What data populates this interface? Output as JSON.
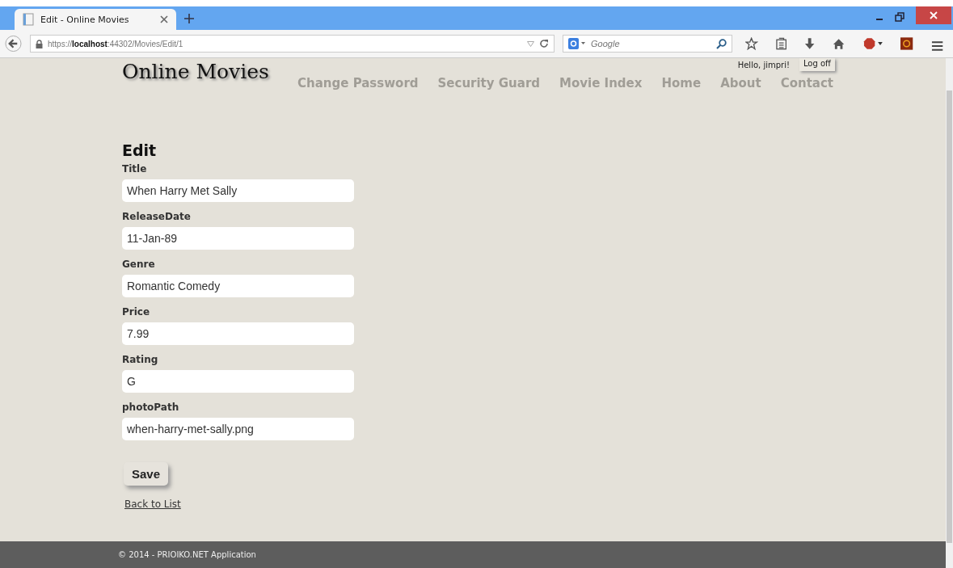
{
  "browser": {
    "tab_title": "Edit - Online Movies",
    "url": "https://**localhost**:44302/Movies/Edit/1",
    "search_placeholder": "Google"
  },
  "site": {
    "brand": "Online Movies",
    "greeting": "Hello, jimpri!",
    "logoff": "Log off",
    "nav": [
      "Change Password",
      "Security Guard",
      "Movie Index",
      "Home",
      "About",
      "Contact"
    ]
  },
  "form": {
    "heading": "Edit",
    "fields": [
      {
        "label": "Title",
        "value": "When Harry Met Sally"
      },
      {
        "label": "ReleaseDate",
        "value": "11-Jan-89"
      },
      {
        "label": "Genre",
        "value": "Romantic Comedy"
      },
      {
        "label": "Price",
        "value": "7.99"
      },
      {
        "label": "Rating",
        "value": "G"
      },
      {
        "label": "photoPath",
        "value": "when-harry-met-sally.png"
      }
    ],
    "save": "Save",
    "back": "Back to List"
  },
  "footer": "© 2014 - PRIOIKO.NET Application"
}
